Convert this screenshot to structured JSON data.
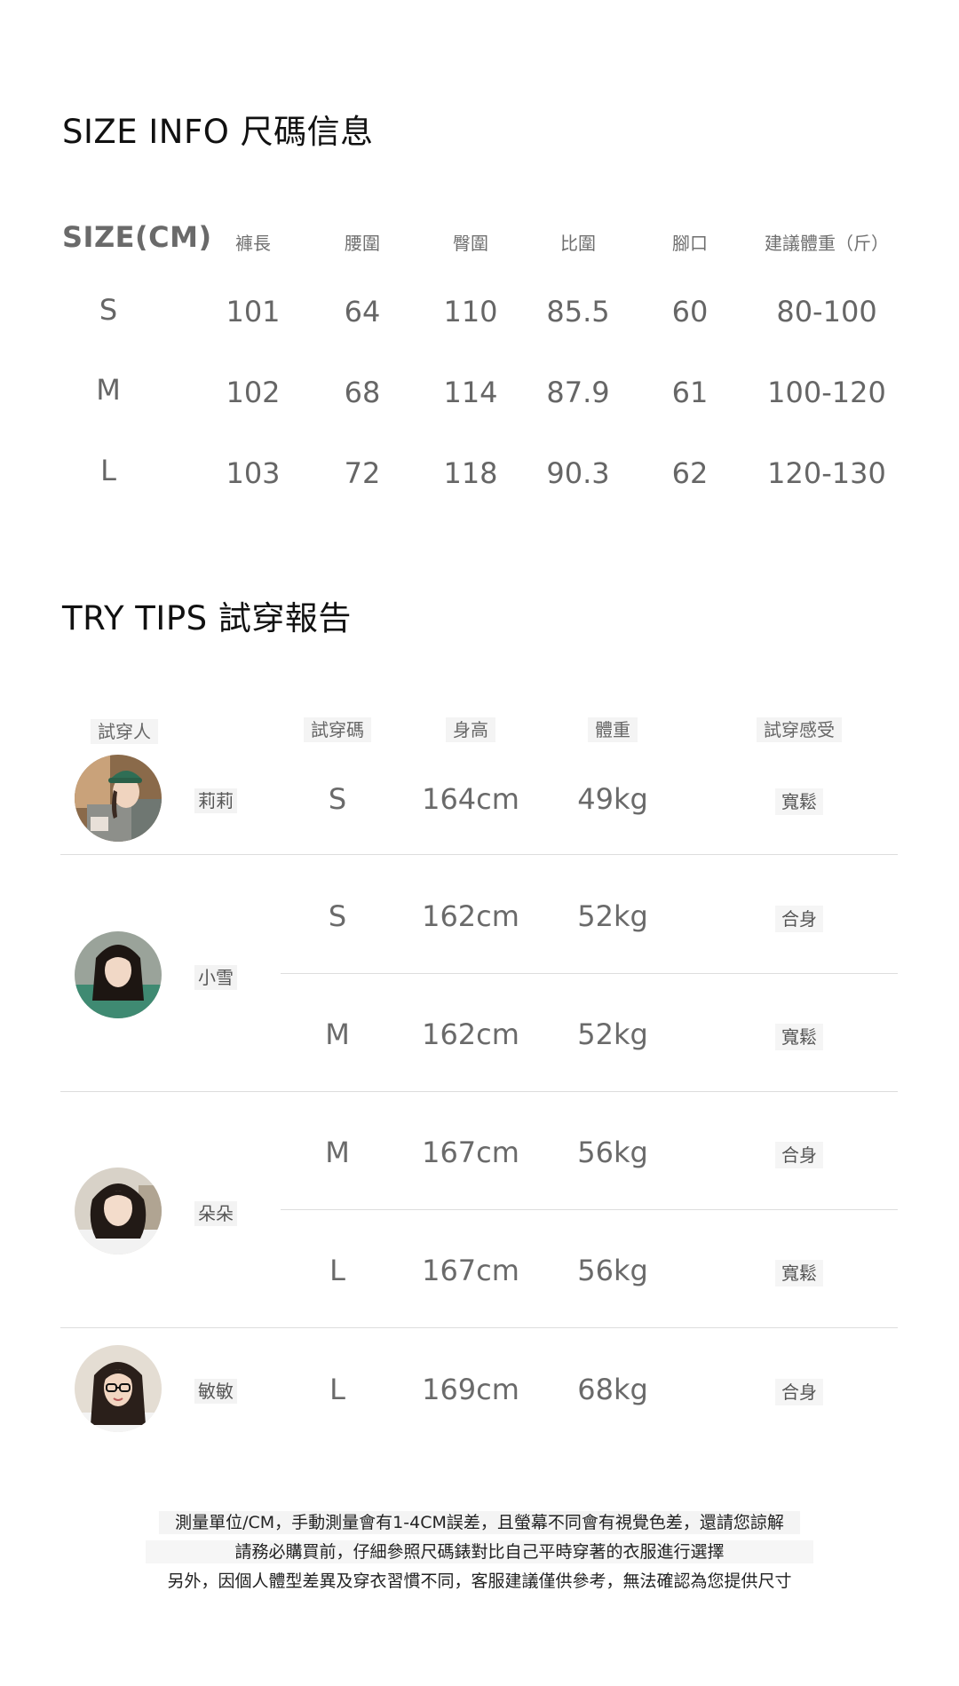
{
  "size_info": {
    "title": "SIZE INFO 尺碼信息",
    "headers": [
      "SIZE(CM)",
      "褲長",
      "腰圍",
      "臀圍",
      "比圍",
      "腳口",
      "建議體重（斤）"
    ],
    "rows": [
      [
        "S",
        "101",
        "64",
        "110",
        "85.5",
        "60",
        "80-100"
      ],
      [
        "M",
        "102",
        "68",
        "114",
        "87.9",
        "61",
        "100-120"
      ],
      [
        "L",
        "103",
        "72",
        "118",
        "90.3",
        "62",
        "120-130"
      ]
    ]
  },
  "try_tips": {
    "title": "TRY TIPS 試穿報告",
    "headers": [
      "試穿人",
      "試穿碼",
      "身高",
      "體重",
      "試穿感受"
    ],
    "people": [
      {
        "name": "莉莉",
        "avatar_icon": "woman-green-cap-avatar-icon",
        "rows": [
          {
            "size": "S",
            "height": "164cm",
            "weight": "49kg",
            "feel": "寬鬆"
          }
        ]
      },
      {
        "name": "小雪",
        "avatar_icon": "woman-long-dark-hair-avatar-icon",
        "rows": [
          {
            "size": "S",
            "height": "162cm",
            "weight": "52kg",
            "feel": "合身"
          },
          {
            "size": "M",
            "height": "162cm",
            "weight": "52kg",
            "feel": "寬鬆"
          }
        ]
      },
      {
        "name": "朵朵",
        "avatar_icon": "woman-wavy-hair-avatar-icon",
        "rows": [
          {
            "size": "M",
            "height": "167cm",
            "weight": "56kg",
            "feel": "合身"
          },
          {
            "size": "L",
            "height": "167cm",
            "weight": "56kg",
            "feel": "寬鬆"
          }
        ]
      },
      {
        "name": "敏敏",
        "avatar_icon": "woman-glasses-avatar-icon",
        "rows": [
          {
            "size": "L",
            "height": "169cm",
            "weight": "68kg",
            "feel": "合身"
          }
        ]
      }
    ]
  },
  "notes": [
    "測量單位/CM，手動測量會有1-4CM誤差，且螢幕不同會有視覺色差，還請您諒解",
    "請務必購買前，仔細參照尺碼錶對比自己平時穿著的衣服進行選擇",
    "另外，因個人體型差異及穿衣習慣不同，客服建議僅供參考，無法確認為您提供尺寸"
  ],
  "colors": {
    "text_dark": "#111111",
    "text_gray": "#666666",
    "divider": "#dddddd",
    "background": "#ffffff"
  }
}
